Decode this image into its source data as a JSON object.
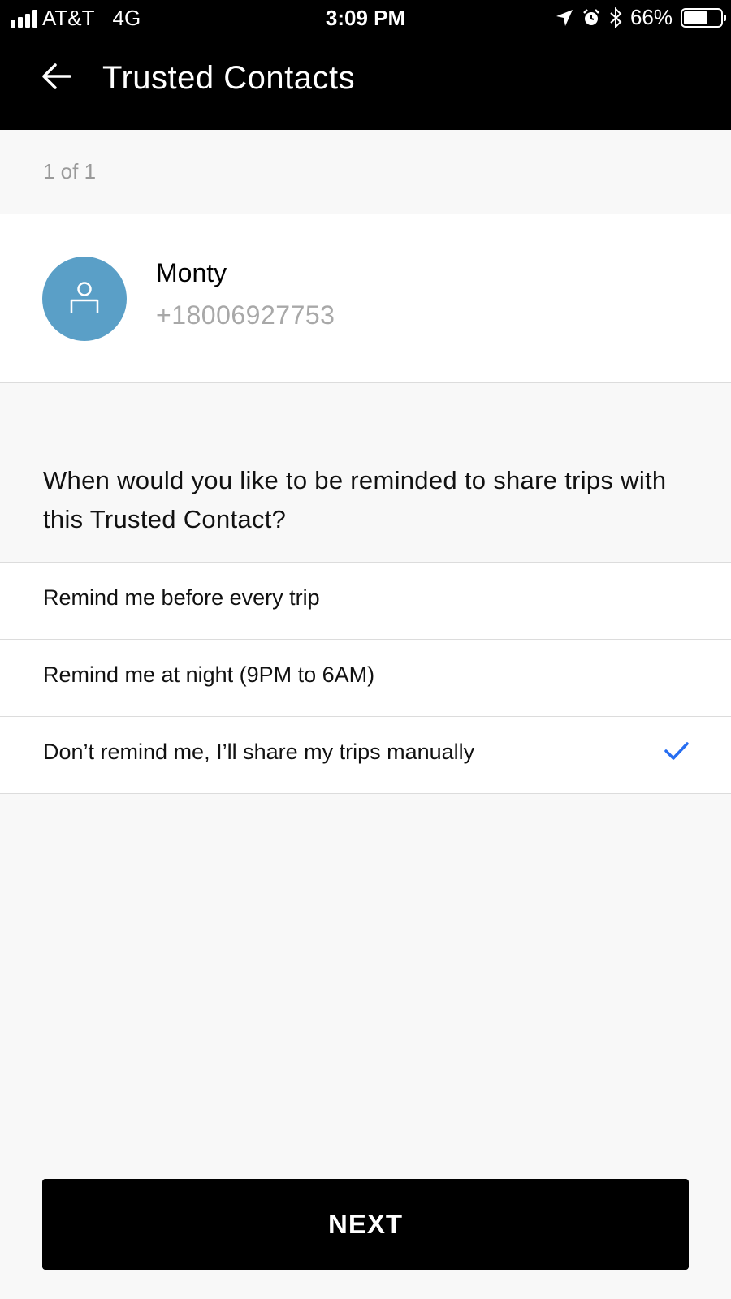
{
  "status_bar": {
    "carrier": "AT&T",
    "network": "4G",
    "time": "3:09 PM",
    "battery_percent": "66%",
    "battery_level": 0.66,
    "icons": [
      "signal-icon",
      "location-icon",
      "alarm-icon",
      "bluetooth-icon",
      "battery-icon"
    ]
  },
  "header": {
    "back_icon": "arrow-left-icon",
    "title": "Trusted Contacts"
  },
  "counter": "1 of 1",
  "contact": {
    "avatar_icon": "person-icon",
    "avatar_color": "#5a9fc7",
    "name": "Monty",
    "phone": "+18006927753"
  },
  "question": "When would you like to be reminded to share trips with this Trusted Contact?",
  "options": [
    {
      "label": "Remind me before every trip",
      "selected": false
    },
    {
      "label": "Remind me at night (9PM to 6AM)",
      "selected": false
    },
    {
      "label": "Don’t remind me, I’ll share my trips manually",
      "selected": true
    }
  ],
  "check_color": "#276ef1",
  "next_label": "NEXT"
}
